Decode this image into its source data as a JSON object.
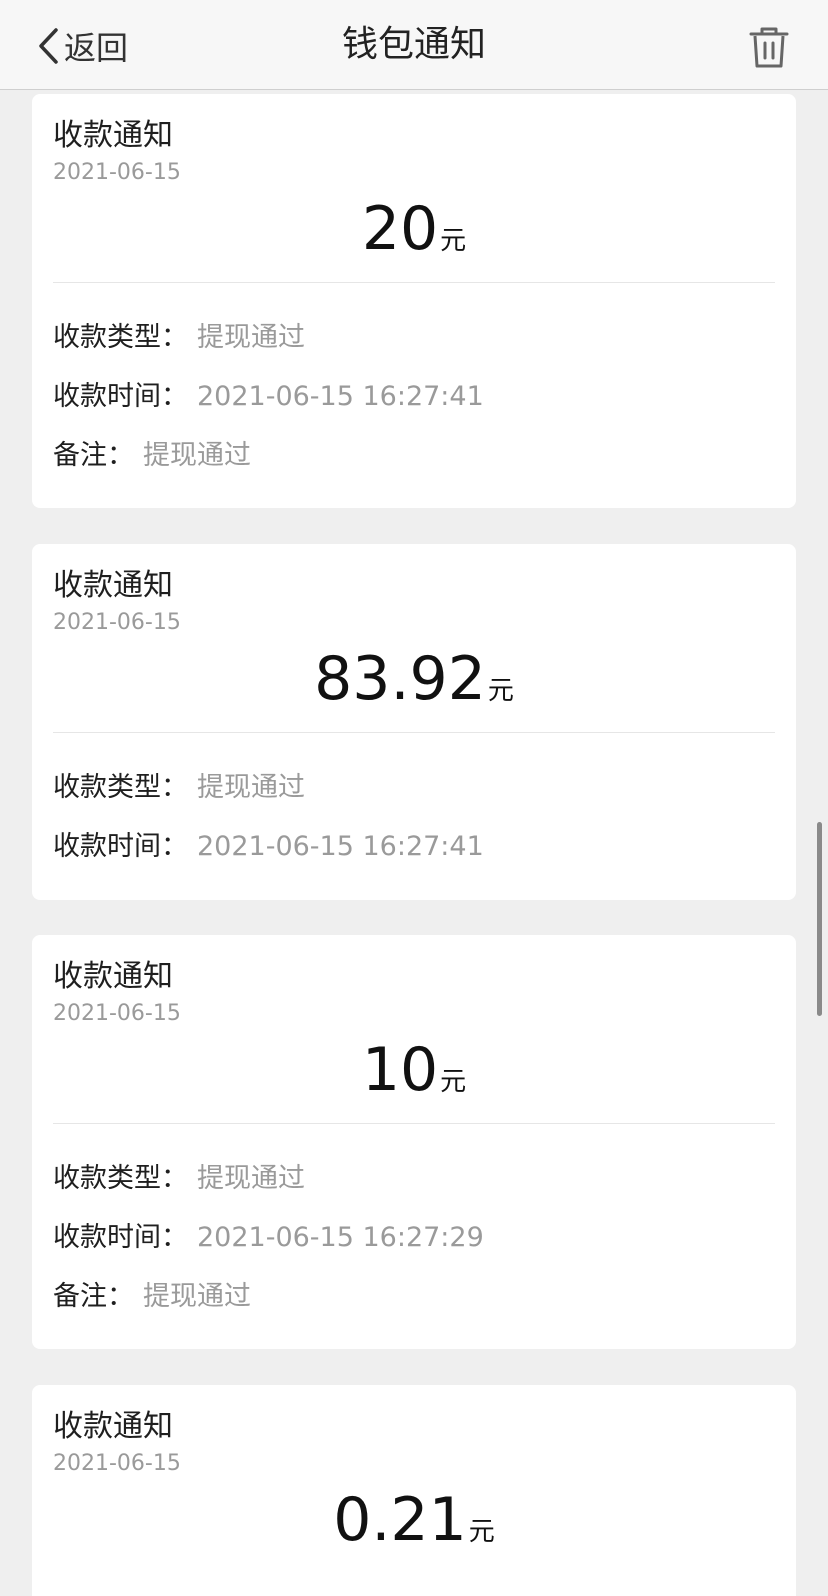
{
  "header": {
    "back_label": "返回",
    "title": "钱包通知",
    "back_icon": "chevron-left-icon",
    "trash_icon": "trash-icon"
  },
  "notifications": [
    {
      "title": "收款通知",
      "date": "2021-06-15",
      "amount": "20",
      "unit": "元",
      "type_label": "收款类型：",
      "type_value": "提现通过",
      "time_label": "收款时间：",
      "time_value": "2021-06-15 16:27:41",
      "note_label": "备注：",
      "note_value": "提现通过"
    },
    {
      "title": "收款通知",
      "date": "2021-06-15",
      "amount": "83.92",
      "unit": "元",
      "type_label": "收款类型：",
      "type_value": "提现通过",
      "time_label": "收款时间：",
      "time_value": "2021-06-15 16:27:41"
    },
    {
      "title": "收款通知",
      "date": "2021-06-15",
      "amount": "10",
      "unit": "元",
      "type_label": "收款类型：",
      "type_value": "提现通过",
      "time_label": "收款时间：",
      "time_value": "2021-06-15 16:27:29",
      "note_label": "备注：",
      "note_value": "提现通过"
    },
    {
      "title": "收款通知",
      "date": "2021-06-15",
      "amount": "0.21",
      "unit": "元"
    }
  ]
}
